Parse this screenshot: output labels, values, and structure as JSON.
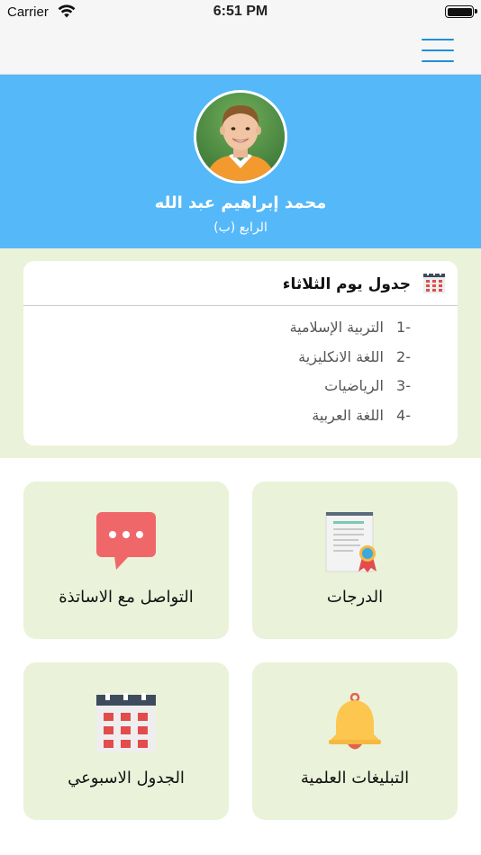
{
  "status_bar": {
    "carrier": "Carrier",
    "time": "6:51 PM"
  },
  "profile": {
    "name": "محمد إبراهيم عبد الله",
    "class": "الرابع (ب)"
  },
  "schedule": {
    "title": "جدول يوم الثلاثاء",
    "items": [
      {
        "num": "-1",
        "subject": "التربية الإسلامية"
      },
      {
        "num": "-2",
        "subject": "اللغة الانكليزية"
      },
      {
        "num": "-3",
        "subject": "الرياضيات"
      },
      {
        "num": "-4",
        "subject": "اللغة العربية"
      }
    ]
  },
  "tiles": {
    "grades": "الدرجات",
    "teachers": "التواصل مع الاساتذة",
    "notices": "التبليغات العلمية",
    "weekly": "الجدول الاسبوعي"
  },
  "colors": {
    "header_blue": "#55b8f8",
    "tile_bg": "#eaf2d9",
    "accent_red": "#f0676a",
    "bell_yellow": "#fcc64f"
  }
}
